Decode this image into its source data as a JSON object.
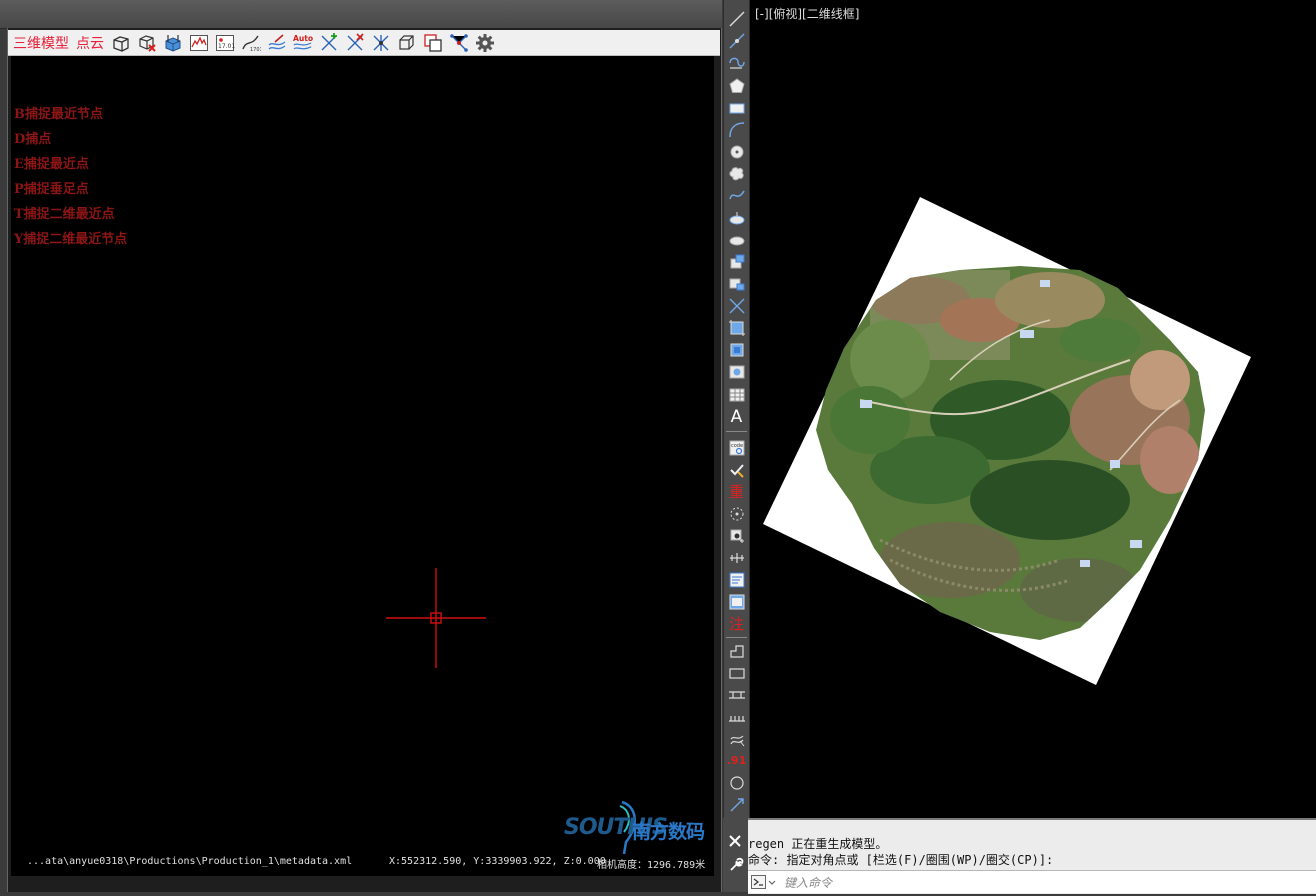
{
  "viewer": {
    "toolbar": {
      "mode_model": "三维模型",
      "mode_pointcloud": "点云",
      "icons": [
        "box-select-icon",
        "box-delete-icon",
        "layer-cube-icon",
        "profile-chart-icon",
        "elevation-label-icon",
        "contour-line-icon",
        "contour-label-icon",
        "auto-contour-icon",
        "snap-point-icon",
        "snap-line-icon",
        "snap-cross-icon",
        "cube-wire-icon",
        "copy-box-icon",
        "node-network-icon",
        "settings-gear-icon"
      ],
      "auto_label": "Auto"
    },
    "snap_options": [
      "B捕捉最近节点",
      "D捕点",
      "E捕捉最近点",
      "P捕捉垂足点",
      "T捕捉二维最近点",
      "Y捕捉二维最近节点"
    ],
    "logo": {
      "brand_en": "SOUTHIS",
      "brand_cn": "南方数码",
      "colors": {
        "primary": "#1f5a8c",
        "accent": "#2a78c8"
      }
    },
    "status": {
      "path": "...ata\\anyue0318\\Productions\\Production_1\\metadata.xml",
      "coords": "X:552312.590, Y:3339903.922, Z:0.000",
      "camera_height": "相机高度：1296.789米"
    }
  },
  "palette": {
    "icons": [
      "line-icon",
      "construction-line-icon",
      "polyline-icon",
      "polygon-icon",
      "rectangle-icon",
      "arc-icon",
      "circle-icon",
      "revision-cloud-icon",
      "spline-icon",
      "ellipse-icon",
      "ellipse-arc-icon",
      "insert-block-icon",
      "make-block-icon",
      "trim-icon",
      "hatch-icon",
      "boundary-icon",
      "region-icon",
      "table-icon",
      "text-icon",
      "code-query-icon",
      "check-icon",
      "regen-icon",
      "point-select-icon",
      "zoom-extents-icon",
      "dimension-icon",
      "edit-attribute-icon",
      "frame-icon",
      "annotate-icon",
      "building-outline-icon",
      "rectangle-outline-icon",
      "road-icon",
      "fence-icon",
      "vegetation-icon",
      "elevation-point-icon",
      "circle-outline-icon",
      "scale-icon"
    ],
    "chars": {
      "text": "A",
      "regen": "重",
      "annotate": "注",
      "elevation": ".91"
    }
  },
  "cad": {
    "view_label": "[-][俯视][二维线框]",
    "command_history": [
      "regen 正在重生成模型。",
      "命令: 指定对角点或 [栏选(F)/圈围(WP)/圈交(CP)]:"
    ],
    "command_placeholder": "键入命令"
  },
  "colors": {
    "snap_text": "#8c1515",
    "toolbar_text": "#e8203a",
    "crosshair": "#d01010"
  }
}
